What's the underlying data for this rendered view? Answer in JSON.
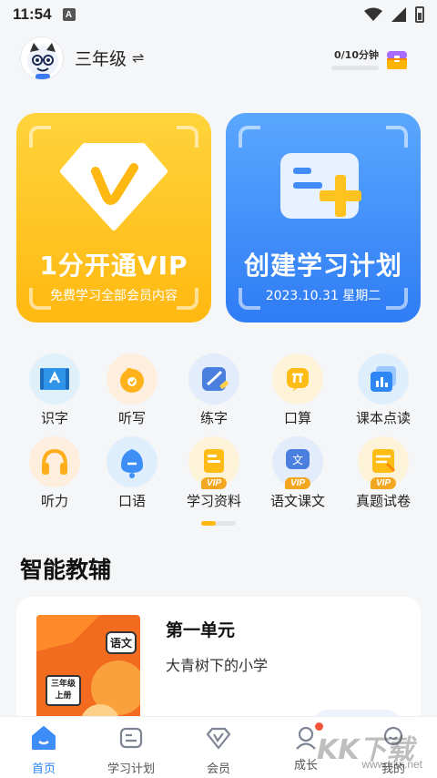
{
  "status": {
    "time": "11:54",
    "badge": "A"
  },
  "header": {
    "grade": "三年级",
    "swap_icon": "⇌",
    "timer": "0/10分钟"
  },
  "cards": {
    "vip": {
      "title": "1分开通VIP",
      "subtitle": "免费学习全部会员内容",
      "color": "#ffc21f"
    },
    "plan": {
      "title": "创建学习计划",
      "subtitle": "2023.10.31 星期二",
      "color": "#3f8cf8"
    }
  },
  "features": [
    {
      "label": "识字",
      "icon": "literacy-icon"
    },
    {
      "label": "听写",
      "icon": "dictation-icon"
    },
    {
      "label": "练字",
      "icon": "handwriting-icon"
    },
    {
      "label": "口算",
      "icon": "mental-math-icon"
    },
    {
      "label": "课本点读",
      "icon": "textbook-reading-icon"
    },
    {
      "label": "听力",
      "icon": "headphones-icon"
    },
    {
      "label": "口语",
      "icon": "speaking-icon"
    },
    {
      "label": "学习资料",
      "icon": "study-materials-icon",
      "vip": "VIP"
    },
    {
      "label": "语文课文",
      "icon": "chinese-text-icon",
      "vip": "VIP"
    },
    {
      "label": "真题试卷",
      "icon": "exam-paper-icon",
      "vip": "VIP"
    }
  ],
  "section": {
    "title": "智能教辅"
  },
  "lesson": {
    "unit": "第一单元",
    "subtitle": "大青树下的小学",
    "book_tag": "语文",
    "book_grade_line1": "三年级",
    "book_grade_line2": "上册"
  },
  "tabs": [
    {
      "label": "首页",
      "icon": "home-icon",
      "active": true
    },
    {
      "label": "学习计划",
      "icon": "study-plan-icon"
    },
    {
      "label": "会员",
      "icon": "vip-icon"
    },
    {
      "label": "成长",
      "icon": "growth-icon"
    },
    {
      "label": "我的",
      "icon": "profile-icon"
    }
  ],
  "watermark": {
    "big": "KK下载",
    "small": "www.kkx.net"
  }
}
